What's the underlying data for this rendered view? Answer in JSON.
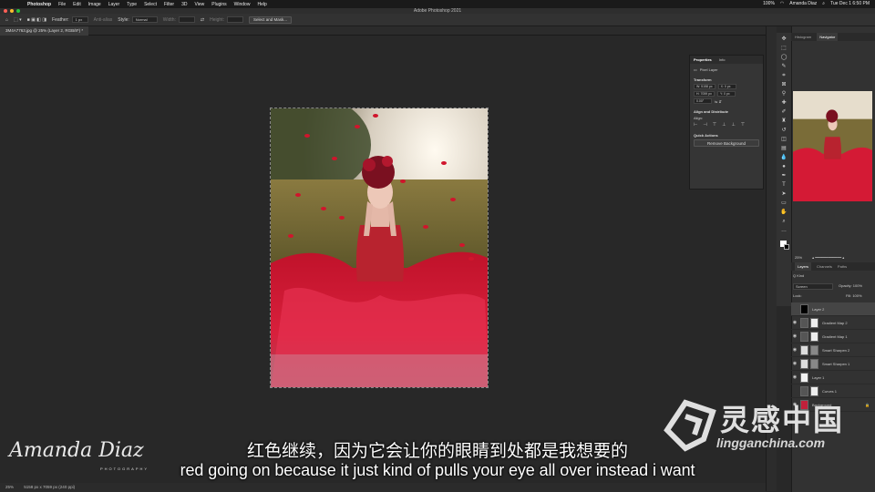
{
  "menubar": {
    "app": "Photoshop",
    "items": [
      "File",
      "Edit",
      "Image",
      "Layer",
      "Type",
      "Select",
      "Filter",
      "3D",
      "View",
      "Plugins",
      "Window",
      "Help"
    ],
    "right": {
      "user": "Amanda Diaz",
      "battery": "100%",
      "datetime": "Tue Dec 1  6:50 PM"
    }
  },
  "window": {
    "title": "Adobe Photoshop 2021"
  },
  "options": {
    "feather_label": "Feather:",
    "feather_value": "1 px",
    "antialias": "Anti-alias",
    "style_label": "Style:",
    "style_value": "Normal",
    "width_label": "Width:",
    "height_label": "Height:",
    "select_mask": "Select and Mask..."
  },
  "document": {
    "tab": "3M4A7763.jpg @ 25% (Layer 2, RGB/8*) *"
  },
  "status": {
    "zoom": "25%",
    "info": "5158 px x 7059 px (240 ppi)"
  },
  "properties": {
    "tabs": [
      "Properties",
      "Info"
    ],
    "kind": "Pixel Layer",
    "transform": {
      "title": "Transform",
      "w": "W: 5158 px",
      "h": "H: 7059 px",
      "x": "X: 0 px",
      "y": "Y: 0 px",
      "angle": "0.00°"
    },
    "align_title": "Align and Distribute",
    "align_label": "Align:",
    "quick_title": "Quick Actions",
    "remove_bg": "Remove Background"
  },
  "navigator": {
    "tabs": [
      "Histogram",
      "Navigator"
    ],
    "zoom": "25%"
  },
  "layers": {
    "tabs": [
      "Layers",
      "Channels",
      "Paths"
    ],
    "kind_label": "Q Kind",
    "blend_mode": "Screen",
    "opacity": "Opacity: 100%",
    "lock_label": "Lock:",
    "fill": "Fill: 100%",
    "items": [
      {
        "name": "Layer 2",
        "selected": true
      },
      {
        "name": "Gradient Map 2",
        "selected": false
      },
      {
        "name": "Gradient Map 1",
        "selected": false
      },
      {
        "name": "Smart Sharpen 2",
        "selected": false
      },
      {
        "name": "Smart Sharpen 1",
        "selected": false
      },
      {
        "name": "Layer 1",
        "selected": false
      },
      {
        "name": "Curves 1",
        "selected": false
      },
      {
        "name": "Background",
        "selected": false
      }
    ]
  },
  "subtitles": {
    "cn": "红色继续，因为它会让你的眼睛到处都是我想要的",
    "en": "red going on because it just kind of pulls your eye all over instead i want"
  },
  "signature": {
    "name": "Amanda Diaz",
    "sub": "PHOTOGRAPHY"
  },
  "watermark": {
    "cn": "灵感中国",
    "en": "lingganchina.com"
  },
  "colors": {
    "accent": "#d41a35",
    "panel": "#323232",
    "canvas": "#282828"
  }
}
